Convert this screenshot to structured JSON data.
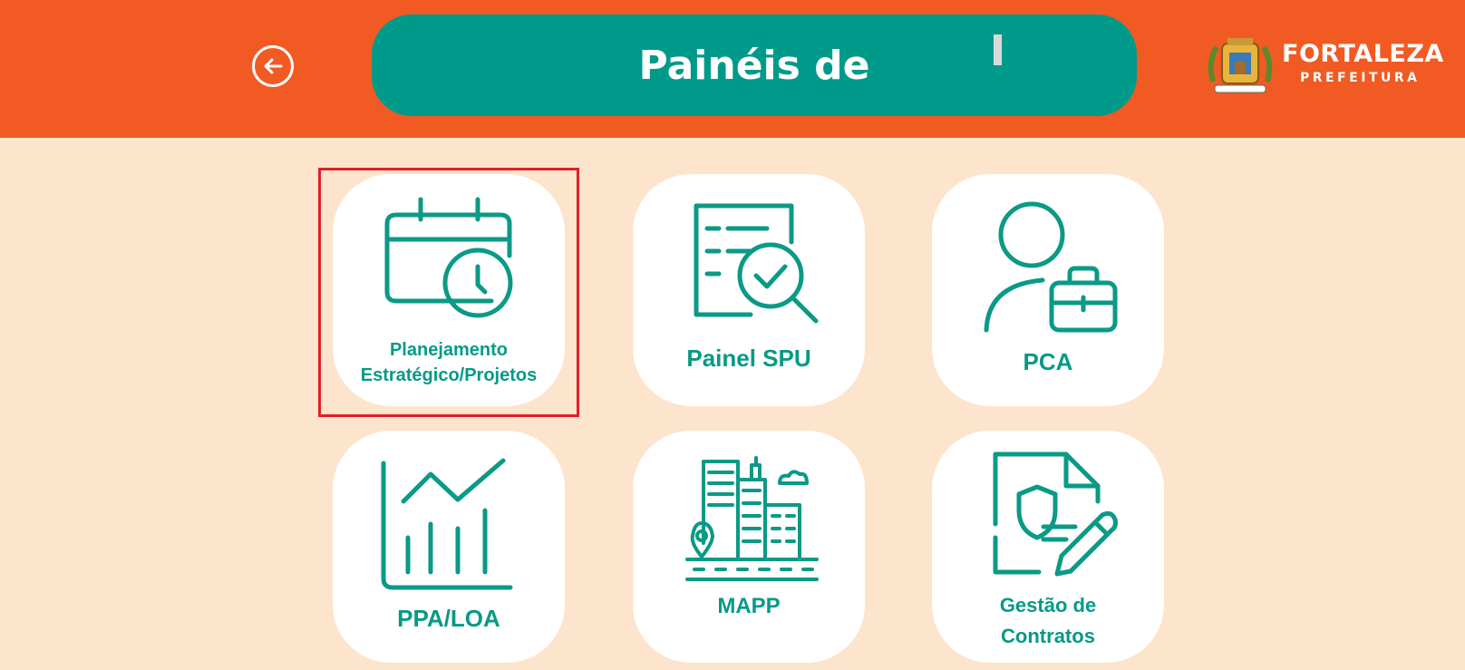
{
  "header": {
    "title": "Painéis de",
    "back_icon": "back-arrow-icon",
    "logo": {
      "name": "FORTALEZA",
      "subtitle": "PREFEITURA"
    }
  },
  "tiles": [
    {
      "label_line1": "Planejamento",
      "label_line2": "Estratégico/Projetos",
      "icon": "calendar-clock-icon",
      "selected": true
    },
    {
      "label": "Painel SPU",
      "icon": "document-search-icon"
    },
    {
      "label": "PCA",
      "icon": "user-briefcase-icon"
    },
    {
      "label": "PPA/LOA",
      "icon": "line-chart-icon"
    },
    {
      "label": "MAPP",
      "icon": "city-location-icon"
    },
    {
      "label_line1": "Gestão de",
      "label_line2": "Contratos",
      "icon": "contract-shield-icon"
    }
  ],
  "colors": {
    "header_bg": "#f15a22",
    "title_pill": "#009a8a",
    "page_bg": "#fde4cc",
    "tile_text": "#079a86",
    "highlight": "#e0202b"
  }
}
